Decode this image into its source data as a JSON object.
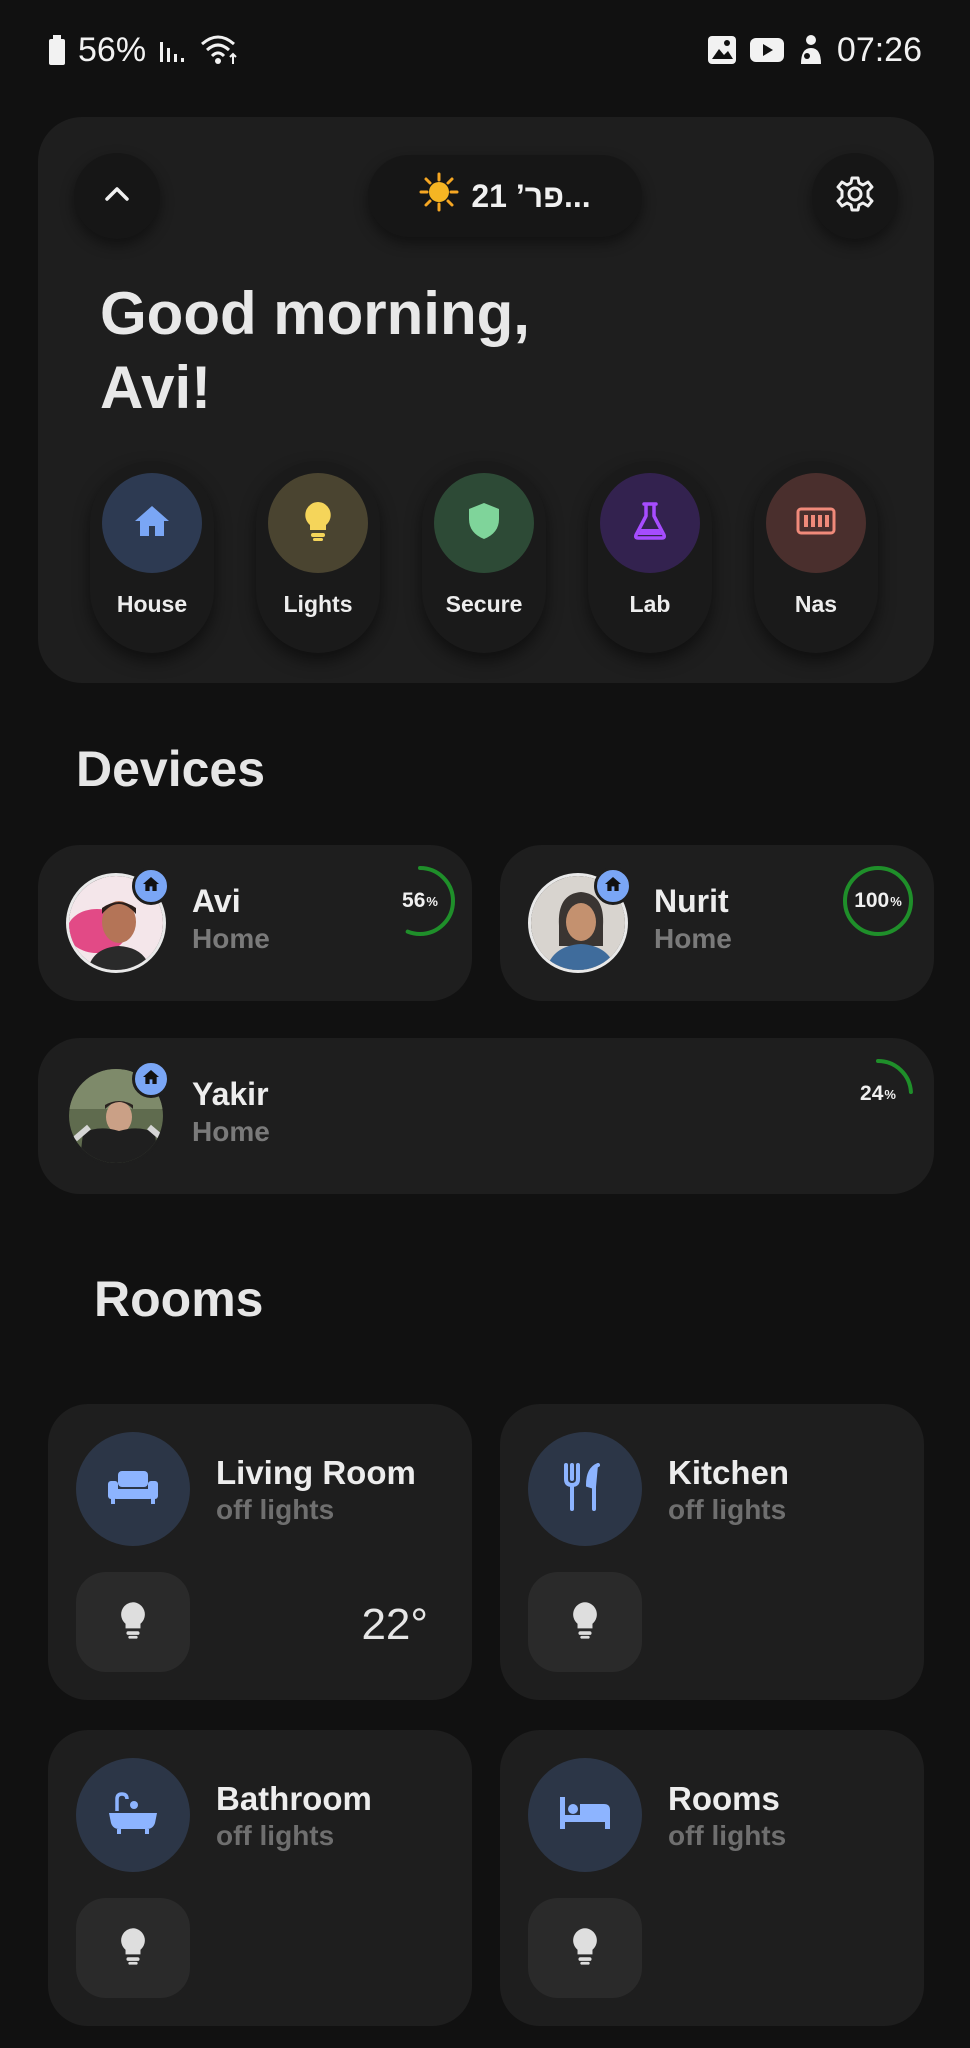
{
  "status_bar": {
    "battery": "56%",
    "time": "07:26"
  },
  "hero": {
    "weather": "21 ’פר...",
    "greeting_line1": "Good morning,",
    "greeting_line2": "Avi!",
    "shortcuts": [
      {
        "label": "House",
        "icon": "home-icon",
        "color": "#7aa6f5",
        "bg": "#2d3a52"
      },
      {
        "label": "Lights",
        "icon": "lightbulb-icon",
        "color": "#f5d55a",
        "bg": "#4a4430"
      },
      {
        "label": "Secure",
        "icon": "shield-icon",
        "color": "#7fd49a",
        "bg": "#2d4a36"
      },
      {
        "label": "Lab",
        "icon": "flask-icon",
        "color": "#a64cff",
        "bg": "#33224f"
      },
      {
        "label": "Nas",
        "icon": "server-icon",
        "color": "#f08a7a",
        "bg": "#4a2f2d"
      }
    ]
  },
  "devices": {
    "title": "Devices",
    "items": [
      {
        "name": "Avi",
        "status": "Home",
        "battery": "56",
        "battery_level": 0.56
      },
      {
        "name": "Nurit",
        "status": "Home",
        "battery": "100",
        "battery_level": 1.0
      },
      {
        "name": "Yakir",
        "status": "Home",
        "battery": "24",
        "battery_level": 0.24
      }
    ],
    "percent_sign": "%"
  },
  "rooms": {
    "title": "Rooms",
    "items": [
      {
        "name": "Living Room",
        "sub": "off lights",
        "icon": "sofa-icon",
        "temp": "22°"
      },
      {
        "name": "Kitchen",
        "sub": "off lights",
        "icon": "cutlery-icon"
      },
      {
        "name": "Bathroom",
        "sub": "off lights",
        "icon": "bathtub-icon"
      },
      {
        "name": "Rooms",
        "sub": "off lights",
        "icon": "bed-icon"
      }
    ]
  },
  "colors": {
    "accent": "#7aa6f5",
    "battery_ring": "#1f8f2a",
    "card": "#1e1e1e",
    "background": "#111111"
  }
}
